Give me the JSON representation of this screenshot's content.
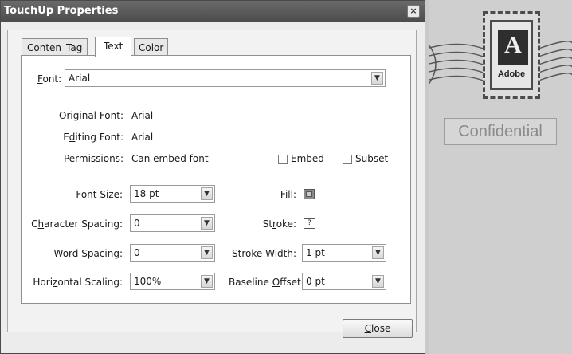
{
  "dialog": {
    "title": "TouchUp Properties",
    "close_glyph": "×",
    "tabs": [
      {
        "label": "Content"
      },
      {
        "label": "Tag"
      },
      {
        "label": "Text"
      },
      {
        "label": "Color"
      }
    ],
    "active_tab": "Text",
    "font": {
      "label_pre": "",
      "label_u": "F",
      "label_post": "ont:",
      "value": "Arial"
    },
    "original_font": {
      "label_pre": "Ori",
      "label_u": "g",
      "label_post": "inal Font:",
      "value": "Arial"
    },
    "editing_font": {
      "label_pre": "E",
      "label_u": "d",
      "label_post": "iting Font:",
      "value": "Arial"
    },
    "permissions": {
      "label": "Permissions:",
      "value": "Can embed font"
    },
    "embed": {
      "label_pre": "",
      "label_u": "E",
      "label_post": "mbed",
      "checked": false
    },
    "subset": {
      "label_pre": "S",
      "label_u": "u",
      "label_post": "bset",
      "checked": false
    },
    "font_size": {
      "label_pre": "Font ",
      "label_u": "S",
      "label_post": "ize:",
      "value": "18 pt"
    },
    "character_spacing": {
      "label_pre": "C",
      "label_u": "h",
      "label_post": "aracter Spacing:",
      "value": "0"
    },
    "word_spacing": {
      "label_pre": "",
      "label_u": "W",
      "label_post": "ord Spacing:",
      "value": "0"
    },
    "horizontal_scaling": {
      "label_pre": "Hori",
      "label_u": "z",
      "label_post": "ontal Scaling:",
      "value": "100%"
    },
    "fill": {
      "label_pre": "F",
      "label_u": "i",
      "label_post": "ll:"
    },
    "stroke": {
      "label_pre": "St",
      "label_u": "r",
      "label_post": "oke:",
      "glyph": "?"
    },
    "stroke_width": {
      "label_pre": "St",
      "label_u": "r",
      "label_post": "oke Width:",
      "value": "1 pt"
    },
    "baseline_offset": {
      "label_pre": "Baseline ",
      "label_u": "O",
      "label_post": "ffset:",
      "value": "0 pt"
    },
    "close_button": {
      "label_pre": "",
      "label_u": "C",
      "label_post": "lose"
    }
  },
  "background": {
    "stamp_letter": "A",
    "stamp_text": "Adobe",
    "watermark": "Confidential"
  },
  "icons": {
    "dropdown": "chevron-down-icon",
    "close": "close-icon",
    "fill": "fill-color-swatch-icon",
    "stroke": "stroke-none-icon"
  }
}
